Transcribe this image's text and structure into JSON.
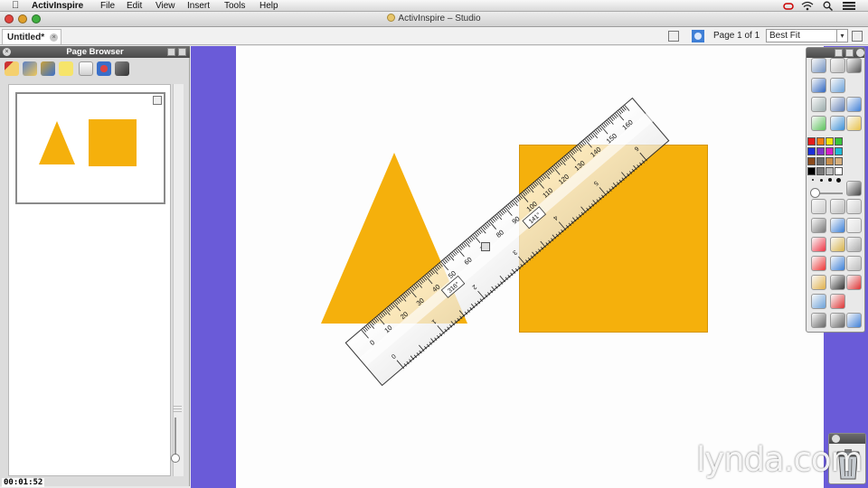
{
  "menubar": {
    "app_name": "ActivInspire",
    "menus": [
      "File",
      "Edit",
      "View",
      "Insert",
      "Tools",
      "Help"
    ]
  },
  "window": {
    "title": "ActivInspire – Studio"
  },
  "doc_toolbar": {
    "tab_label": "Untitled*",
    "page_indicator": "Page 1 of 1",
    "zoom_value": "Best Fit"
  },
  "page_browser": {
    "title": "Page Browser"
  },
  "ruler": {
    "scale_labels": [
      "0",
      "10",
      "20",
      "30",
      "40",
      "50",
      "60",
      "70",
      "80",
      "90",
      "100",
      "110",
      "120",
      "130",
      "140",
      "150",
      "160"
    ],
    "angle_readouts": [
      "316°",
      "141°"
    ],
    "inch_labels": [
      "0",
      "1",
      "2",
      "3",
      "4",
      "5",
      "6"
    ]
  },
  "colors": {
    "shape_fill": "#f5b00c",
    "workspace_bg": "#6a5bd8",
    "palette": [
      "#e31b1b",
      "#f07c13",
      "#f2e20c",
      "#3ac43a",
      "#1a2fd9",
      "#7e33c8",
      "#d61fc6",
      "#1fbad6",
      "#8a4a1b",
      "#6b6b6b",
      "#c78d4a",
      "#d6b07f",
      "#000000",
      "#7a7a7a",
      "#bdbdbd",
      "#ffffff"
    ]
  },
  "overlay": {
    "watermark": "lynda.com",
    "timecode": "00:01:52"
  }
}
